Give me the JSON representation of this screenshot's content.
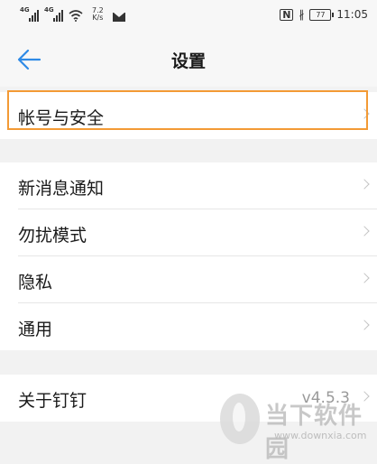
{
  "status_bar": {
    "signal1_label": "4G",
    "signal2_label": "4G",
    "net_speed": "7.2",
    "net_unit": "K/s",
    "nfc": "N",
    "bluetooth": "∦",
    "battery": "77",
    "time": "11:05"
  },
  "nav": {
    "title": "设置"
  },
  "groups": {
    "account": {
      "label": "帐号与安全"
    },
    "message": {
      "label": "新消息通知"
    },
    "dnd": {
      "label": "勿扰模式"
    },
    "privacy": {
      "label": "隐私"
    },
    "general": {
      "label": "通用"
    },
    "about": {
      "label": "关于钉钉",
      "value": "v4.5.3"
    }
  },
  "watermark": {
    "text": "当下软件园",
    "url": "www.downxia.com"
  },
  "colors": {
    "highlight": "#f39a35",
    "accent": "#2e8ae6"
  }
}
